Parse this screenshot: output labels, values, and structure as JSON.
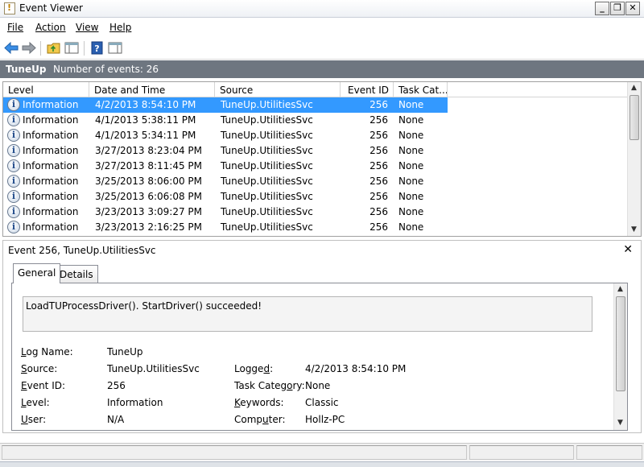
{
  "window": {
    "title": "Event Viewer"
  },
  "menu": {
    "items": [
      "File",
      "Action",
      "View",
      "Help"
    ]
  },
  "toolbar": {
    "back_icon": "arrow-left-icon",
    "forward_icon": "arrow-right-icon",
    "up_icon": "folder-up-icon",
    "console_icon": "console-tree-icon",
    "help_icon": "help-icon",
    "panel_icon": "action-pane-icon"
  },
  "log": {
    "name": "TuneUp",
    "count_text": "Number of events: 26"
  },
  "columns": [
    "Level",
    "Date and Time",
    "Source",
    "Event ID",
    "Task Cat..."
  ],
  "events": [
    {
      "level": "Information",
      "datetime": "4/2/2013 8:54:10 PM",
      "source": "TuneUp.UtilitiesSvc",
      "event_id": "256",
      "task": "None"
    },
    {
      "level": "Information",
      "datetime": "4/1/2013 5:38:11 PM",
      "source": "TuneUp.UtilitiesSvc",
      "event_id": "256",
      "task": "None"
    },
    {
      "level": "Information",
      "datetime": "4/1/2013 5:34:11 PM",
      "source": "TuneUp.UtilitiesSvc",
      "event_id": "256",
      "task": "None"
    },
    {
      "level": "Information",
      "datetime": "3/27/2013 8:23:04 PM",
      "source": "TuneUp.UtilitiesSvc",
      "event_id": "256",
      "task": "None"
    },
    {
      "level": "Information",
      "datetime": "3/27/2013 8:11:45 PM",
      "source": "TuneUp.UtilitiesSvc",
      "event_id": "256",
      "task": "None"
    },
    {
      "level": "Information",
      "datetime": "3/25/2013 8:06:00 PM",
      "source": "TuneUp.UtilitiesSvc",
      "event_id": "256",
      "task": "None"
    },
    {
      "level": "Information",
      "datetime": "3/25/2013 6:06:08 PM",
      "source": "TuneUp.UtilitiesSvc",
      "event_id": "256",
      "task": "None"
    },
    {
      "level": "Information",
      "datetime": "3/23/2013 3:09:27 PM",
      "source": "TuneUp.UtilitiesSvc",
      "event_id": "256",
      "task": "None"
    },
    {
      "level": "Information",
      "datetime": "3/23/2013 2:16:25 PM",
      "source": "TuneUp.UtilitiesSvc",
      "event_id": "256",
      "task": "None"
    }
  ],
  "detail": {
    "title": "Event 256, TuneUp.UtilitiesSvc",
    "close": "✕",
    "tabs": [
      "General",
      "Details"
    ],
    "message": "LoadTUProcessDriver(). StartDriver() succeeded!",
    "log_name_label": "Log Name:",
    "log_name": "TuneUp",
    "source_label": "Source:",
    "source": "TuneUp.UtilitiesSvc",
    "event_id_label": "Event ID:",
    "event_id": "256",
    "level_label": "Level:",
    "level": "Information",
    "user_label": "User:",
    "user": "N/A",
    "logged_label": "Logged:",
    "logged": "4/2/2013 8:54:10 PM",
    "task_label": "Task Category:",
    "task": "None",
    "keywords_label": "Keywords:",
    "keywords": "Classic",
    "computer_label": "Computer:",
    "computer": "Hollz-PC"
  },
  "colors": {
    "selection": "#3399ff",
    "header_strip": "#6e7680"
  }
}
